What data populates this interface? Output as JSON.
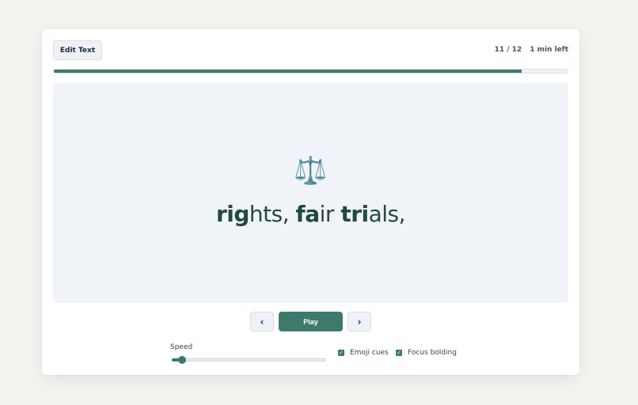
{
  "toolbar": {
    "edit_label": "Edit Text"
  },
  "status": {
    "position": "11 / 12",
    "time_left": "1 min left"
  },
  "progress": {
    "current": 11,
    "total": 12,
    "fraction": 0.91
  },
  "reader": {
    "emoji": "⚖️",
    "words": [
      {
        "bold": "rig",
        "rest": "hts,"
      },
      {
        "bold": "fa",
        "rest": "ir"
      },
      {
        "bold": "tri",
        "rest": "als,"
      }
    ]
  },
  "controls": {
    "prev_icon": "chevron-left-icon",
    "next_icon": "chevron-right-icon",
    "prev_glyph": "‹",
    "next_glyph": "›",
    "play_label": "Play"
  },
  "settings": {
    "speed_label": "Speed",
    "speed_fraction": 0.04,
    "emoji_cues_label": "Emoji cues",
    "emoji_cues_checked": true,
    "focus_bolding_label": "Focus bolding",
    "focus_bolding_checked": true
  },
  "colors": {
    "accent": "#3d7a6c",
    "text_dark": "#1f4a40",
    "panel": "#f0f3f7"
  }
}
